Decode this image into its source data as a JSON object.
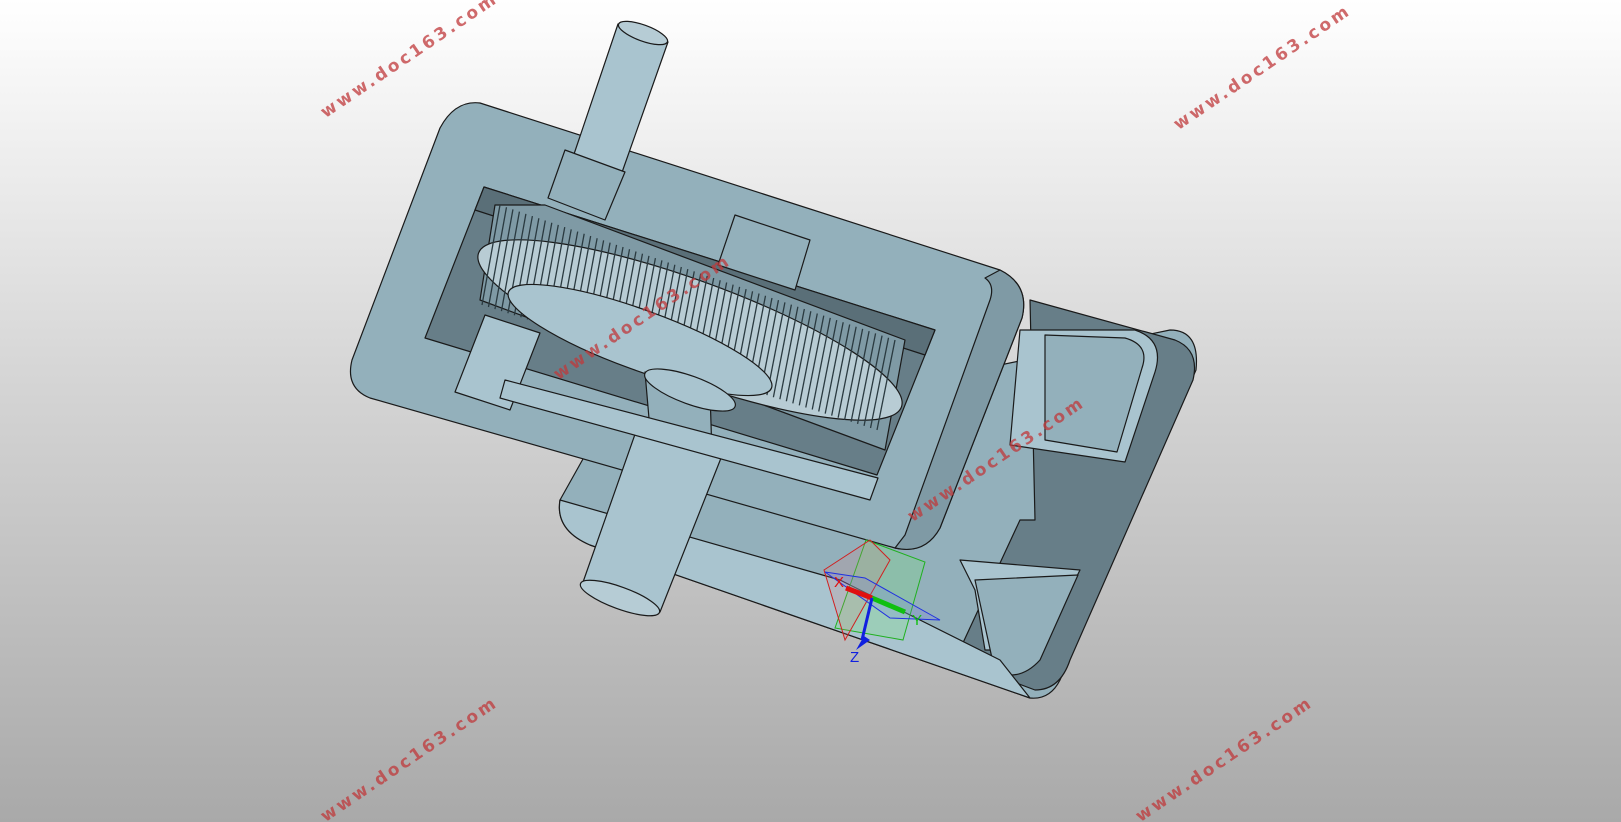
{
  "watermark": {
    "text": "www.doc163.com",
    "color": "#c0393b"
  },
  "triad": {
    "x_label": "X",
    "y_label": "Y",
    "z_label": "Z",
    "x_color": "#e01010",
    "y_color": "#10c010",
    "z_color": "#1020e0"
  },
  "model": {
    "body_color": "#93b0bb",
    "edge_color": "#1a1a1a",
    "dark_face_color": "#677e88",
    "light_face_color": "#a9c4cf"
  }
}
